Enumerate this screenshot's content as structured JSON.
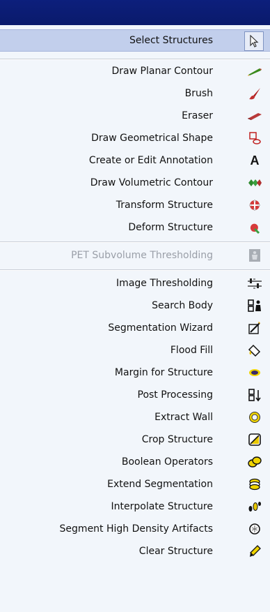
{
  "menu": {
    "select": {
      "label": "Select Structures",
      "icon": "arrow-cursor-icon"
    },
    "group1": [
      {
        "label": "Draw Planar Contour",
        "icon": "pencil-icon"
      },
      {
        "label": "Brush",
        "icon": "brush-icon"
      },
      {
        "label": "Eraser",
        "icon": "eraser-icon"
      },
      {
        "label": "Draw Geometrical Shape",
        "icon": "shape-icon"
      },
      {
        "label": "Create or Edit Annotation",
        "icon": "annotation-a-icon"
      },
      {
        "label": "Draw Volumetric Contour",
        "icon": "volumetric-contour-icon"
      },
      {
        "label": "Transform Structure",
        "icon": "transform-icon"
      },
      {
        "label": "Deform Structure",
        "icon": "deform-icon"
      }
    ],
    "pet": {
      "label": "PET Subvolume Thresholding",
      "icon": "pet-icon",
      "disabled": true
    },
    "group2": [
      {
        "label": "Image Thresholding",
        "icon": "threshold-icon"
      },
      {
        "label": "Search Body",
        "icon": "search-body-icon"
      },
      {
        "label": "Segmentation Wizard",
        "icon": "wand-icon"
      },
      {
        "label": "Flood Fill",
        "icon": "bucket-icon"
      },
      {
        "label": "Margin for Structure",
        "icon": "margin-icon"
      },
      {
        "label": "Post Processing",
        "icon": "post-processing-icon"
      },
      {
        "label": "Extract Wall",
        "icon": "ring-icon"
      },
      {
        "label": "Crop Structure",
        "icon": "crop-icon"
      },
      {
        "label": "Boolean Operators",
        "icon": "boolean-icon"
      },
      {
        "label": "Extend Segmentation",
        "icon": "stack-icon"
      },
      {
        "label": "Interpolate Structure",
        "icon": "interpolate-icon"
      },
      {
        "label": "Segment High Density Artifacts",
        "icon": "artifact-icon"
      },
      {
        "label": "Clear Structure",
        "icon": "clear-icon"
      }
    ]
  }
}
